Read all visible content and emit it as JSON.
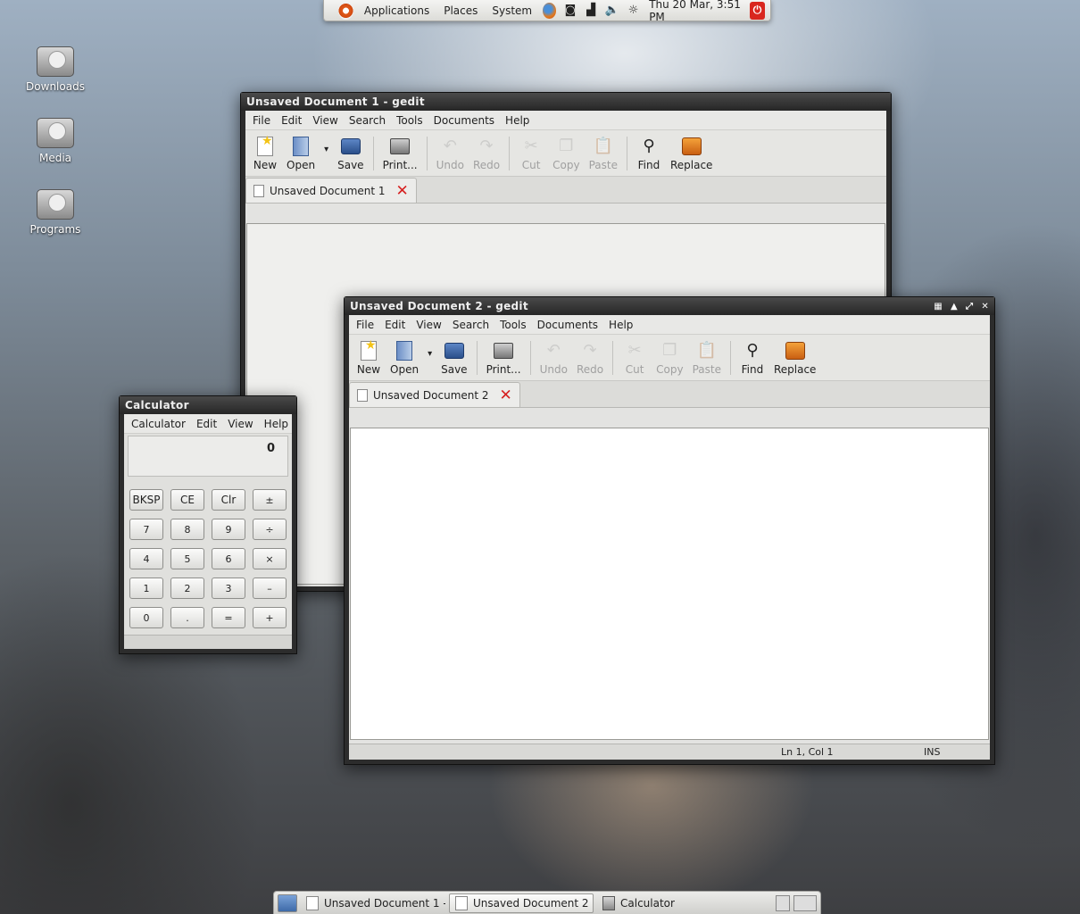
{
  "top_panel": {
    "menus": [
      "Applications",
      "Places",
      "System"
    ],
    "clock": "Thu 20 Mar,  3:51 PM"
  },
  "desktop": {
    "icons": [
      {
        "label": "Downloads"
      },
      {
        "label": "Media"
      },
      {
        "label": "Programs"
      }
    ]
  },
  "gedit1": {
    "title": "Unsaved Document 1 - gedit",
    "menus": [
      "File",
      "Edit",
      "View",
      "Search",
      "Tools",
      "Documents",
      "Help"
    ],
    "toolbar": {
      "new": "New",
      "open": "Open",
      "save": "Save",
      "print": "Print...",
      "undo": "Undo",
      "redo": "Redo",
      "cut": "Cut",
      "copy": "Copy",
      "paste": "Paste",
      "find": "Find",
      "replace": "Replace"
    },
    "tab_label": "Unsaved Document 1"
  },
  "gedit2": {
    "title": "Unsaved Document 2 - gedit",
    "menus": [
      "File",
      "Edit",
      "View",
      "Search",
      "Tools",
      "Documents",
      "Help"
    ],
    "toolbar": {
      "new": "New",
      "open": "Open",
      "save": "Save",
      "print": "Print...",
      "undo": "Undo",
      "redo": "Redo",
      "cut": "Cut",
      "copy": "Copy",
      "paste": "Paste",
      "find": "Find",
      "replace": "Replace"
    },
    "tab_label": "Unsaved Document 2",
    "status": {
      "position": "Ln 1, Col 1",
      "mode": "INS"
    }
  },
  "calculator": {
    "title": "Calculator",
    "menus": [
      "Calculator",
      "Edit",
      "View",
      "Help"
    ],
    "display": "0",
    "keys": [
      "BKSP",
      "CE",
      "Clr",
      "±",
      "7",
      "8",
      "9",
      "÷",
      "4",
      "5",
      "6",
      "×",
      "1",
      "2",
      "3",
      "–",
      "0",
      ".",
      "=",
      "+"
    ]
  },
  "taskbar": {
    "tasks": [
      "Unsaved Document 1 -...",
      "Unsaved Document 2 ...",
      "Calculator"
    ]
  }
}
